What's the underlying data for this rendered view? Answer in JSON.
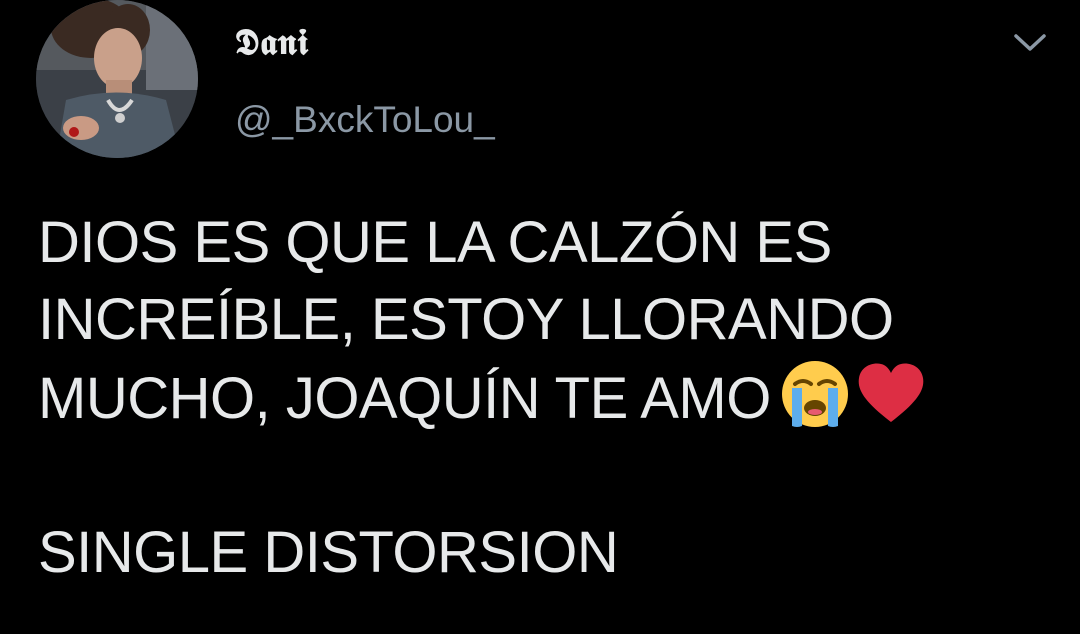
{
  "author": {
    "display_name": "𝕯𝖆𝖓𝖎",
    "handle": "@_BxckToLou_",
    "avatar_icon": "profile-photo"
  },
  "menu": {
    "icon": "chevron-down-icon"
  },
  "tweet": {
    "line1": "DIOS ES QUE LA CALZÓN ES",
    "line2": "INCREÍBLE, ESTOY LLORANDO",
    "line3": "MUCHO, JOAQUÍN TE AMO",
    "line5": "SINGLE DISTORSION",
    "emojis": [
      "loudly-crying-face-emoji",
      "red-heart-emoji"
    ]
  },
  "colors": {
    "background": "#000000",
    "text": "#e7e9ea",
    "secondary_text": "#8b98a5",
    "heart": "#dd2e44",
    "emoji_face": "#ffcc4d",
    "tears": "#5dadec"
  }
}
